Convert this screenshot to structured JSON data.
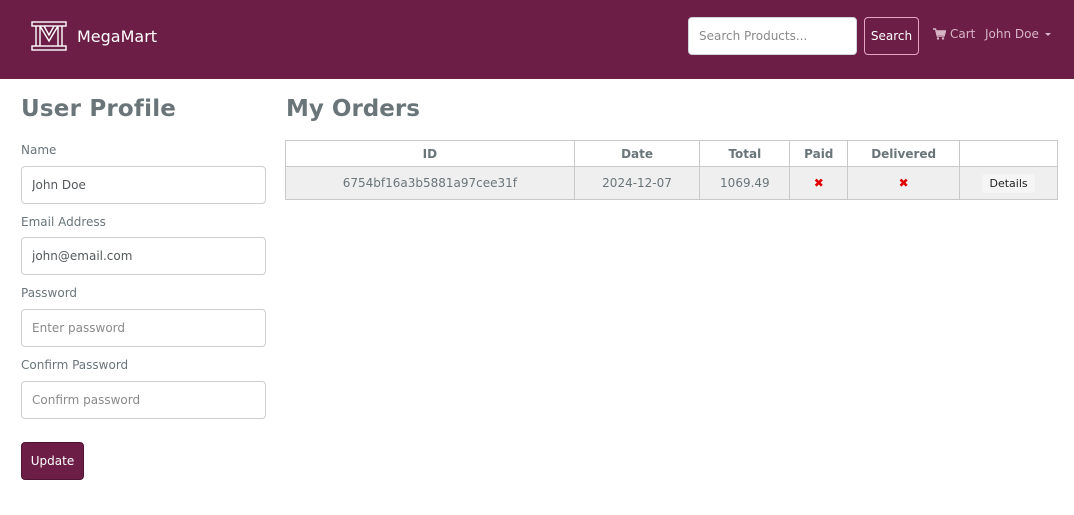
{
  "navbar": {
    "brand": "MegaMart",
    "search": {
      "placeholder": "Search Products..."
    },
    "search_button": "Search",
    "cart_label": "Cart",
    "user_name": "John Doe",
    "colors": {
      "background": "#6c1e46"
    }
  },
  "profile": {
    "title": "User Profile",
    "name": {
      "label": "Name",
      "value": "John Doe"
    },
    "email": {
      "label": "Email Address",
      "value": "john@email.com"
    },
    "password": {
      "label": "Password",
      "placeholder": "Enter password"
    },
    "confirm_password": {
      "label": "Confirm Password",
      "placeholder": "Confirm password"
    },
    "update_button": "Update"
  },
  "orders": {
    "title": "My Orders",
    "columns": [
      "ID",
      "Date",
      "Total",
      "Paid",
      "Delivered",
      ""
    ],
    "rows": [
      {
        "id": "6754bf16a3b5881a97cee31f",
        "date": "2024-12-07",
        "total": "1069.49",
        "paid": "✖",
        "delivered": "✖",
        "action": "Details"
      }
    ]
  }
}
